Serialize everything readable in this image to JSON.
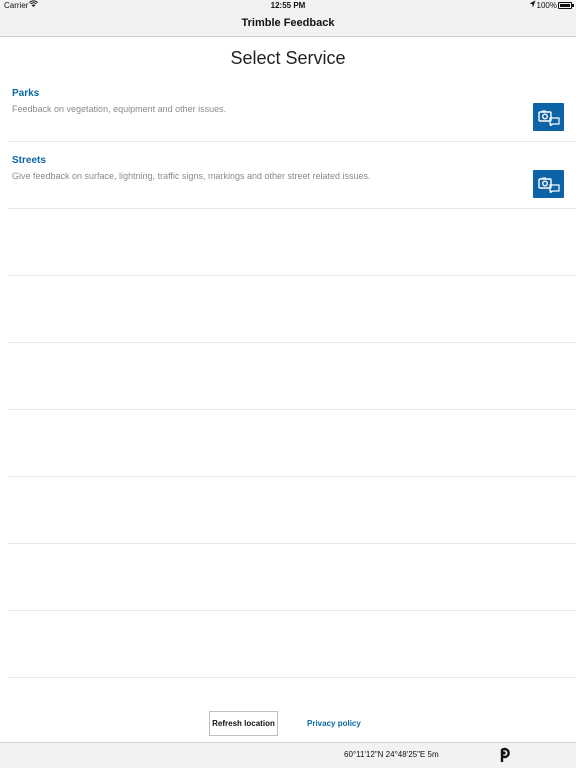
{
  "status_bar": {
    "carrier": "Carrier",
    "time": "12:55 PM",
    "battery": "100%"
  },
  "nav": {
    "title": "Trimble Feedback"
  },
  "main": {
    "title": "Select Service",
    "services": [
      {
        "name": "Parks",
        "description": "Feedback on vegetation, equipment and other issues."
      },
      {
        "name": "Streets",
        "description": "Give feedback on surface, lightning, traffic signs, markings and other street related issues."
      }
    ]
  },
  "footer": {
    "refresh_label": "Refresh location",
    "privacy_label": "Privacy policy"
  },
  "location": {
    "coords": "60°11'12\"N 24°48'25\"E 5m"
  },
  "colors": {
    "accent": "#0c63a5",
    "link": "#0a67a3"
  },
  "icons": [
    "wifi-icon",
    "location-arrow-icon",
    "battery-icon",
    "camera-feedback-icon",
    "map-pin-icon"
  ]
}
